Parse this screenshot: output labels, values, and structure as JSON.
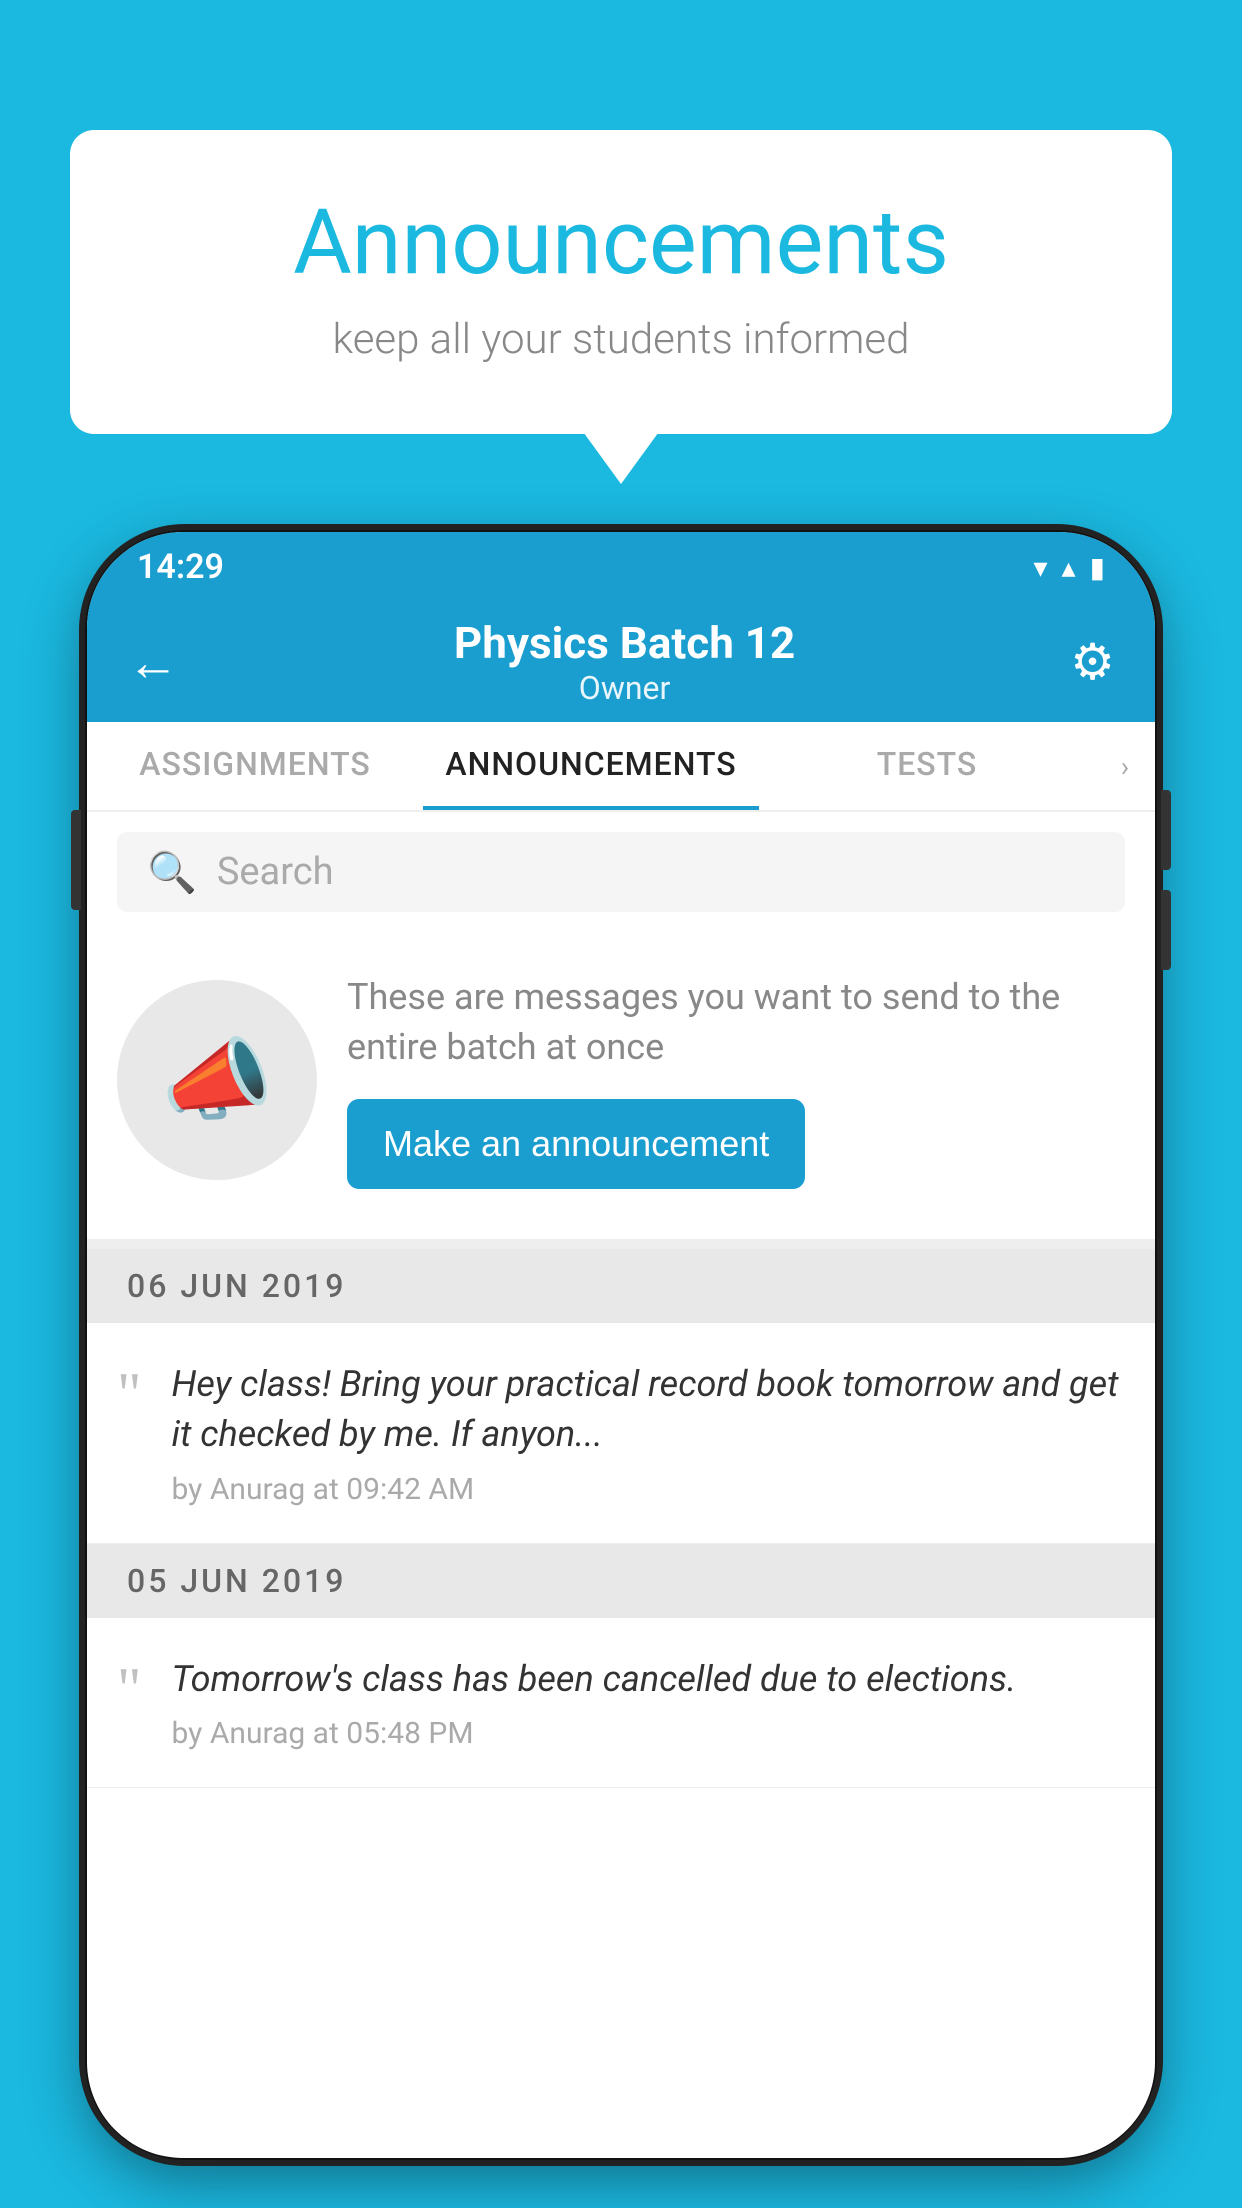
{
  "bubble": {
    "title": "Announcements",
    "subtitle": "keep all your students informed"
  },
  "status_bar": {
    "time": "14:29",
    "wifi": "▼",
    "signal": "▲",
    "battery": "▮"
  },
  "header": {
    "title": "Physics Batch 12",
    "subtitle": "Owner",
    "back_label": "←",
    "gear_label": "⚙"
  },
  "tabs": [
    {
      "label": "ASSIGNMENTS",
      "active": false
    },
    {
      "label": "ANNOUNCEMENTS",
      "active": true
    },
    {
      "label": "TESTS",
      "active": false
    }
  ],
  "search": {
    "placeholder": "Search"
  },
  "promo": {
    "text": "These are messages you want to send to the entire batch at once",
    "button_label": "Make an announcement"
  },
  "announcements": [
    {
      "date": "06  JUN  2019",
      "text": "Hey class! Bring your practical record book tomorrow and get it checked by me. If anyon...",
      "author": "by Anurag at 09:42 AM"
    },
    {
      "date": "05  JUN  2019",
      "text": "Tomorrow's class has been cancelled due to elections.",
      "author": "by Anurag at 05:48 PM"
    }
  ]
}
